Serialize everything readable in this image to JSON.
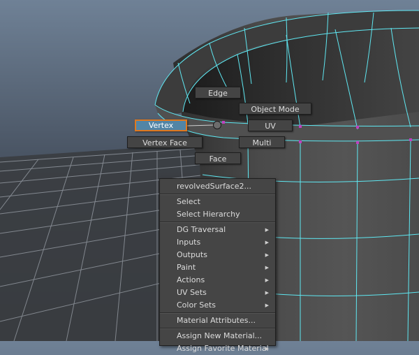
{
  "marking_menu": {
    "edge": "Edge",
    "object_mode": "Object Mode",
    "vertex": "Vertex",
    "uv": "UV",
    "vertex_face": "Vertex Face",
    "multi": "Multi",
    "face": "Face",
    "selected_item": "Vertex"
  },
  "context_menu": {
    "title": "revolvedSurface2...",
    "items": [
      {
        "label": "Select",
        "submenu": false
      },
      {
        "label": "Select Hierarchy",
        "submenu": false
      },
      {
        "label": "DG Traversal",
        "submenu": true
      },
      {
        "label": "Inputs",
        "submenu": true
      },
      {
        "label": "Outputs",
        "submenu": true
      },
      {
        "label": "Paint",
        "submenu": true
      },
      {
        "label": "Actions",
        "submenu": true
      },
      {
        "label": "UV Sets",
        "submenu": true
      },
      {
        "label": "Color Sets",
        "submenu": true
      },
      {
        "label": "Material Attributes...",
        "submenu": false
      },
      {
        "label": "Assign New Material...",
        "submenu": false
      },
      {
        "label": "Assign Favorite Material",
        "submenu": true
      }
    ]
  },
  "colors": {
    "wireframe": "#5fe8f2",
    "vertex_marker": "#c040c0",
    "highlight_border": "#e0781e",
    "highlight_fill": "#5285a6"
  }
}
